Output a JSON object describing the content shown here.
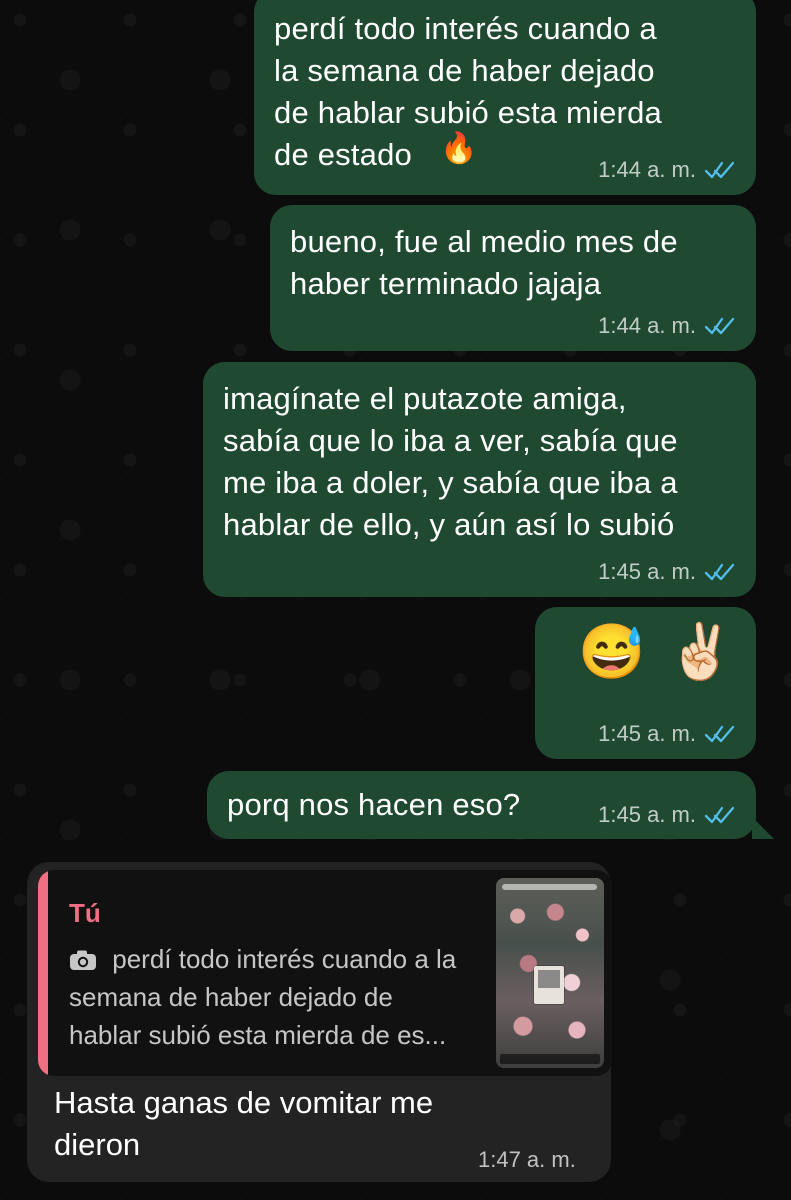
{
  "messages": [
    {
      "id": "m1",
      "text": "perdí todo interés cuando a\nla semana de haber dejado\nde hablar subió esta mierda\nde estado",
      "emoji": "🔥",
      "time": "1:44 a. m."
    },
    {
      "id": "m2",
      "text": "bueno, fue al medio mes de\nhaber terminado jajaja",
      "time": "1:44 a. m."
    },
    {
      "id": "m3",
      "text": "imagínate el putazote amiga,\nsabía que lo iba a ver, sabía que\nme iba a doler, y sabía que iba a\nhablar de ello, y aún así lo subió",
      "time": "1:45 a. m."
    },
    {
      "id": "m4",
      "emoji_1": "😅",
      "emoji_2": "✌🏻",
      "time": "1:45 a. m."
    },
    {
      "id": "m5",
      "text": "porq nos hacen eso?",
      "time": "1:45 a. m."
    }
  ],
  "reply_message": {
    "quoted_author": "Tú",
    "quoted_text": "perdí todo interés cuando a la\nsemana de haber dejado de\nhablar subió esta mierda de es...",
    "text": "Hasta ganas de vomitar me\ndieron",
    "time": "1:47 a. m."
  },
  "icons": {
    "camera": "camera-icon",
    "ticks": "double-check-icon"
  },
  "colors": {
    "outgoing_bubble": "#1f4a31",
    "incoming_bubble": "#232323",
    "reply_bar": "#f06f83",
    "ticks": "#53bdeb"
  }
}
